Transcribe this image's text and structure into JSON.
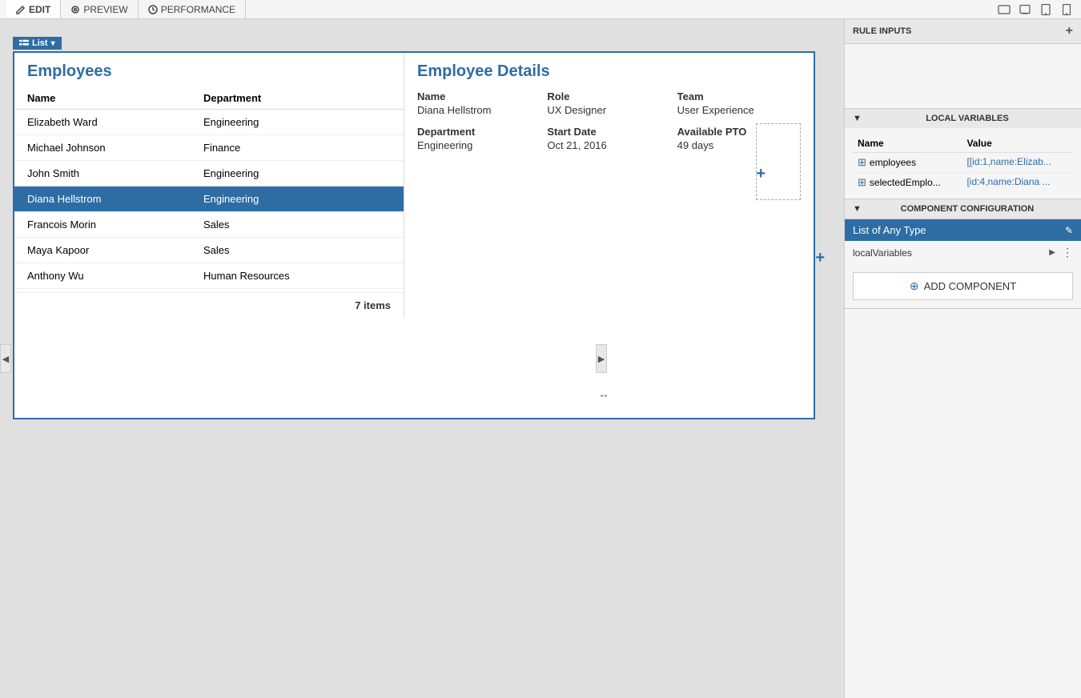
{
  "toolbar": {
    "tabs": [
      {
        "id": "edit",
        "label": "EDIT",
        "active": true
      },
      {
        "id": "preview",
        "label": "PREVIEW",
        "active": false
      },
      {
        "id": "performance",
        "label": "PERFORMANCE",
        "active": false
      }
    ]
  },
  "list_badge": {
    "label": "List",
    "chevron": "▾"
  },
  "employees_section": {
    "title": "Employees",
    "headers": {
      "name": "Name",
      "department": "Department"
    },
    "rows": [
      {
        "name": "Elizabeth Ward",
        "department": "Engineering",
        "selected": false
      },
      {
        "name": "Michael Johnson",
        "department": "Finance",
        "selected": false
      },
      {
        "name": "John Smith",
        "department": "Engineering",
        "selected": false
      },
      {
        "name": "Diana Hellstrom",
        "department": "Engineering",
        "selected": true
      },
      {
        "name": "Francois Morin",
        "department": "Sales",
        "selected": false
      },
      {
        "name": "Maya Kapoor",
        "department": "Sales",
        "selected": false
      },
      {
        "name": "Anthony Wu",
        "department": "Human Resources",
        "selected": false
      }
    ],
    "item_count": "7 items"
  },
  "detail_section": {
    "title": "Employee Details",
    "fields": [
      {
        "label": "Name",
        "value": "Diana Hellstrom"
      },
      {
        "label": "Role",
        "value": "UX Designer"
      },
      {
        "label": "Team",
        "value": "User Experience"
      },
      {
        "label": "Department",
        "value": "Engineering"
      },
      {
        "label": "Start Date",
        "value": "Oct 21, 2016"
      },
      {
        "label": "Available PTO",
        "value": "49 days"
      }
    ]
  },
  "right_panel": {
    "rule_inputs_header": "RULE INPUTS",
    "rule_inputs_add": "+",
    "local_variables_header": "LOCAL VARIABLES",
    "lv_columns": {
      "name": "Name",
      "value": "Value"
    },
    "local_variables": [
      {
        "name": "employees",
        "value": "[[id:1,name:Elizab..."
      },
      {
        "name": "selectedEmplo...",
        "value": "[id:4,name:Diana ..."
      }
    ],
    "component_config_header": "COMPONENT CONFIGURATION",
    "component_name": "List of Any Type",
    "edit_icon": "✎",
    "local_vars_row_label": "localVariables",
    "local_vars_arrow": "▶",
    "add_component_label": "ADD COMPONENT",
    "add_component_circle": "⊕"
  }
}
